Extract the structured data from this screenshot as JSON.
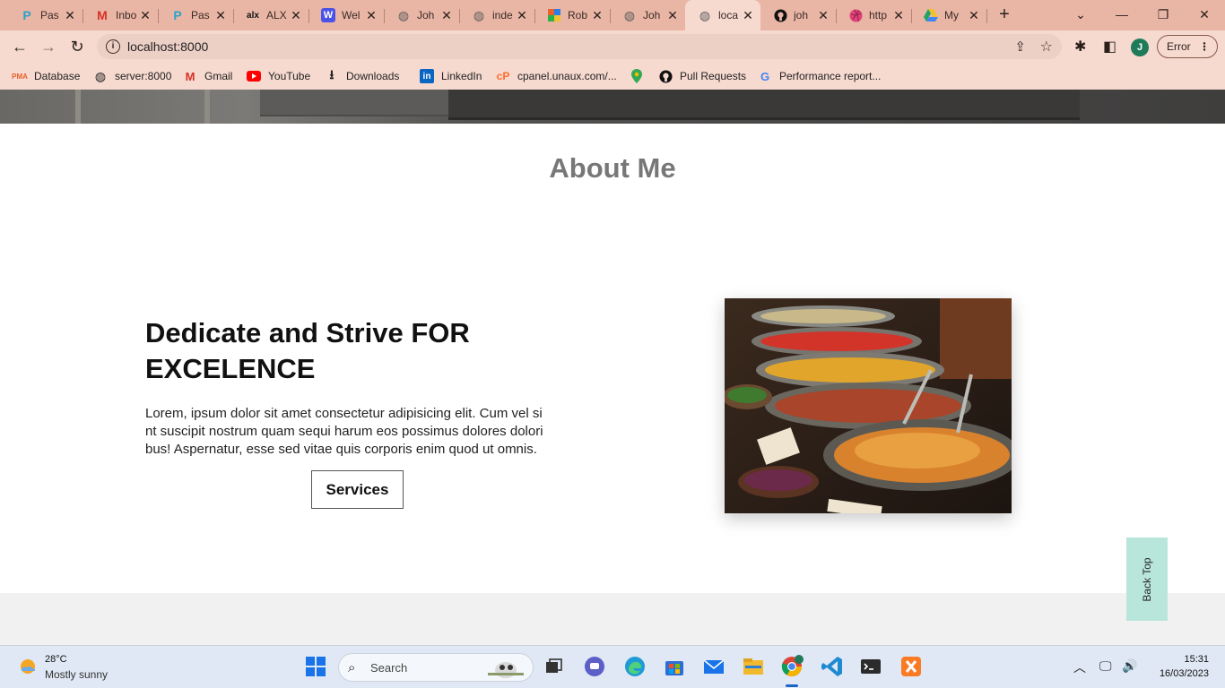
{
  "browser": {
    "tabs": [
      {
        "label": "Pas",
        "icon": "p-icon",
        "color": "#2aa3c8"
      },
      {
        "label": "Inbo",
        "icon": "gmail-icon",
        "color": "#d93025"
      },
      {
        "label": "Pas",
        "icon": "p-icon",
        "color": "#2aa3c8"
      },
      {
        "label": "ALX",
        "icon": "alx-icon",
        "color": "#111111"
      },
      {
        "label": "Wel",
        "icon": "w-icon",
        "color": "#4b53e6"
      },
      {
        "label": "Joh",
        "icon": "globe-icon",
        "color": "#5a5a5a"
      },
      {
        "label": "inde",
        "icon": "globe-icon",
        "color": "#5a5a5a"
      },
      {
        "label": "Rob",
        "icon": "colorful-icon",
        "color": "#e8632b"
      },
      {
        "label": "Joh",
        "icon": "globe-icon",
        "color": "#5a5a5a"
      },
      {
        "label": "loca",
        "icon": "globe-icon",
        "color": "#5a5a5a",
        "active": true
      },
      {
        "label": "joh",
        "icon": "github-icon",
        "color": "#111111"
      },
      {
        "label": "http",
        "icon": "dribbble-icon",
        "color": "#e0447a"
      },
      {
        "label": "My",
        "icon": "drive-icon",
        "color": "#1fa463"
      }
    ],
    "url": "localhost:8000",
    "profile_initial": "J",
    "error_label": "Error",
    "bookmarks": [
      {
        "label": "Database",
        "icon": "pma-icon"
      },
      {
        "label": "server:8000",
        "icon": "globe-icon"
      },
      {
        "label": "Gmail",
        "icon": "gmail-icon"
      },
      {
        "label": "YouTube",
        "icon": "youtube-icon"
      },
      {
        "label": "Downloads",
        "icon": "download-icon"
      },
      {
        "label": "LinkedIn",
        "icon": "linkedin-icon"
      },
      {
        "label": "cpanel.unaux.com/...",
        "icon": "cpanel-icon"
      },
      {
        "label": "",
        "icon": "maps-icon"
      },
      {
        "label": "Pull Requests",
        "icon": "github-icon"
      },
      {
        "label": "Performance report...",
        "icon": "google-icon"
      }
    ]
  },
  "page": {
    "section_title": "About Me",
    "headline_line1": "Dedicate and Strive FOR",
    "headline_line2": "EXCELENCE",
    "body_line1": "Lorem, ipsum dolor sit amet consectetur adipisicing elit. Cum vel si",
    "body_line2": "nt suscipit nostrum quam sequi harum eos possimus dolores dolori",
    "body_line3": "bus! Aspernatur, esse sed vitae quis corporis enim quod ut omnis.",
    "services_label": "Services",
    "back_top_label": "Back Top"
  },
  "taskbar": {
    "temperature": "28°C",
    "condition": "Mostly sunny",
    "search_label": "Search",
    "time": "15:31",
    "date": "16/03/2023"
  }
}
